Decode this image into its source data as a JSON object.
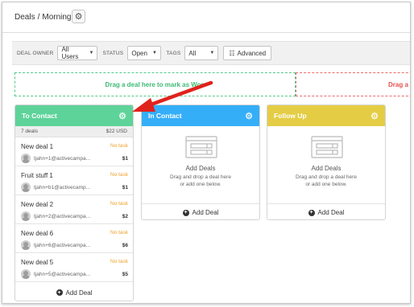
{
  "header": {
    "breadcrumb_root": "Deals",
    "breadcrumb_sep": "/",
    "pipeline_name": "Morning",
    "settings_icon": "gear-icon"
  },
  "filters": {
    "deal_owner_label": "DEAL OWNER",
    "deal_owner_value": "All Users",
    "status_label": "STATUS",
    "status_value": "Open",
    "tags_label": "TAGS",
    "tags_value": "All",
    "advanced_label": "Advanced"
  },
  "dropzones": {
    "won": "Drag a deal here to mark as Won",
    "lost": "Drag a d"
  },
  "columns": [
    {
      "title": "To Contact",
      "color": "#5dd399",
      "stats": {
        "count": "7 deals",
        "total": "$22 USD"
      },
      "deals": [
        {
          "title": "New deal 1",
          "task": "No task",
          "email": "tjahn+1@activecampa...",
          "value": "$1"
        },
        {
          "title": "Fruit stuff 1",
          "task": "No task",
          "email": "tjahn+b1@activecamp...",
          "value": "$1"
        },
        {
          "title": "New deal 2",
          "task": "No task",
          "email": "tjahn+2@activecampa...",
          "value": "$2"
        },
        {
          "title": "New deal 6",
          "task": "No task",
          "email": "tjahn+6@activecampa...",
          "value": "$6"
        },
        {
          "title": "New deal 5",
          "task": "No task",
          "email": "tjahn+5@activecampa...",
          "value": "$5"
        }
      ],
      "add_label": "Add Deal"
    },
    {
      "title": "In Contact",
      "color": "#35aef8",
      "empty_title": "Add Deals",
      "empty_line1": "Drag and drop a deal here",
      "empty_line2": "or add one below.",
      "add_label": "Add Deal"
    },
    {
      "title": "Follow Up",
      "color": "#e4cd45",
      "empty_title": "Add Deals",
      "empty_line1": "Drag and drop a deal here",
      "empty_line2": "or add one below.",
      "add_label": "Add Deal"
    }
  ],
  "annotation": {
    "arrow_color": "#e0221c"
  }
}
